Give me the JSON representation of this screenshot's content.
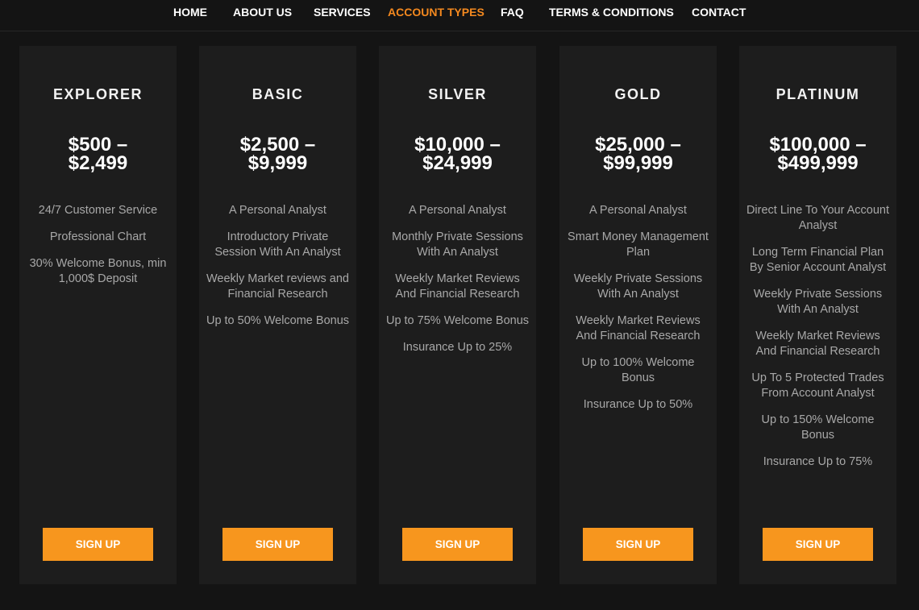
{
  "nav": {
    "items": [
      {
        "label": "HOME",
        "active": false
      },
      {
        "label": "ABOUT US",
        "active": false
      },
      {
        "label": "SERVICES",
        "active": false
      },
      {
        "label": "ACCOUNT TYPES",
        "active": true
      },
      {
        "label": "FAQ",
        "active": false
      },
      {
        "label": "TERMS & CONDITIONS",
        "active": false
      },
      {
        "label": "CONTACT",
        "active": false
      }
    ]
  },
  "colors": {
    "accent": "#f4891f",
    "button": "#f7961e",
    "card_bg": "#1d1d1d",
    "page_bg": "#141414"
  },
  "plans": [
    {
      "title": "EXPLORER",
      "price_line1": "$500 –",
      "price_line2": "$2,499",
      "features": [
        "24/7 Customer Service",
        "Professional Chart",
        "30% Welcome Bonus, min 1,000$ Deposit"
      ],
      "button": "SIGN UP"
    },
    {
      "title": "BASIC",
      "price_line1": "$2,500 –",
      "price_line2": "$9,999",
      "features": [
        "A Personal Analyst",
        "Introductory Private Session With An Analyst",
        "Weekly Market reviews and Financial Research",
        "Up to 50% Welcome Bonus"
      ],
      "button": "SIGN UP"
    },
    {
      "title": "SILVER",
      "price_line1": "$10,000 –",
      "price_line2": "$24,999",
      "features": [
        "A Personal Analyst",
        "Monthly Private Sessions With An Analyst",
        "Weekly Market Reviews And Financial Research",
        "Up to 75% Welcome Bonus",
        "Insurance Up to 25%"
      ],
      "button": "SIGN UP"
    },
    {
      "title": "GOLD",
      "price_line1": "$25,000 –",
      "price_line2": "$99,999",
      "features": [
        "A Personal Analyst",
        "Smart Money Management Plan",
        "Weekly Private Sessions With An Analyst",
        "Weekly Market Reviews And Financial Research",
        "Up to 100% Welcome Bonus",
        "Insurance Up to 50%"
      ],
      "button": "SIGN UP"
    },
    {
      "title": "PLATINUM",
      "price_line1": "$100,000 –",
      "price_line2": "$499,999",
      "features": [
        "Direct Line To Your Account Analyst",
        "Long Term Financial Plan By Senior Account Analyst",
        "Weekly Private Sessions With An Analyst",
        "Weekly Market Reviews And Financial Research",
        "Up To 5 Protected Trades From Account Analyst",
        "Up to 150% Welcome Bonus",
        "Insurance Up to 75%"
      ],
      "button": "SIGN UP"
    }
  ]
}
